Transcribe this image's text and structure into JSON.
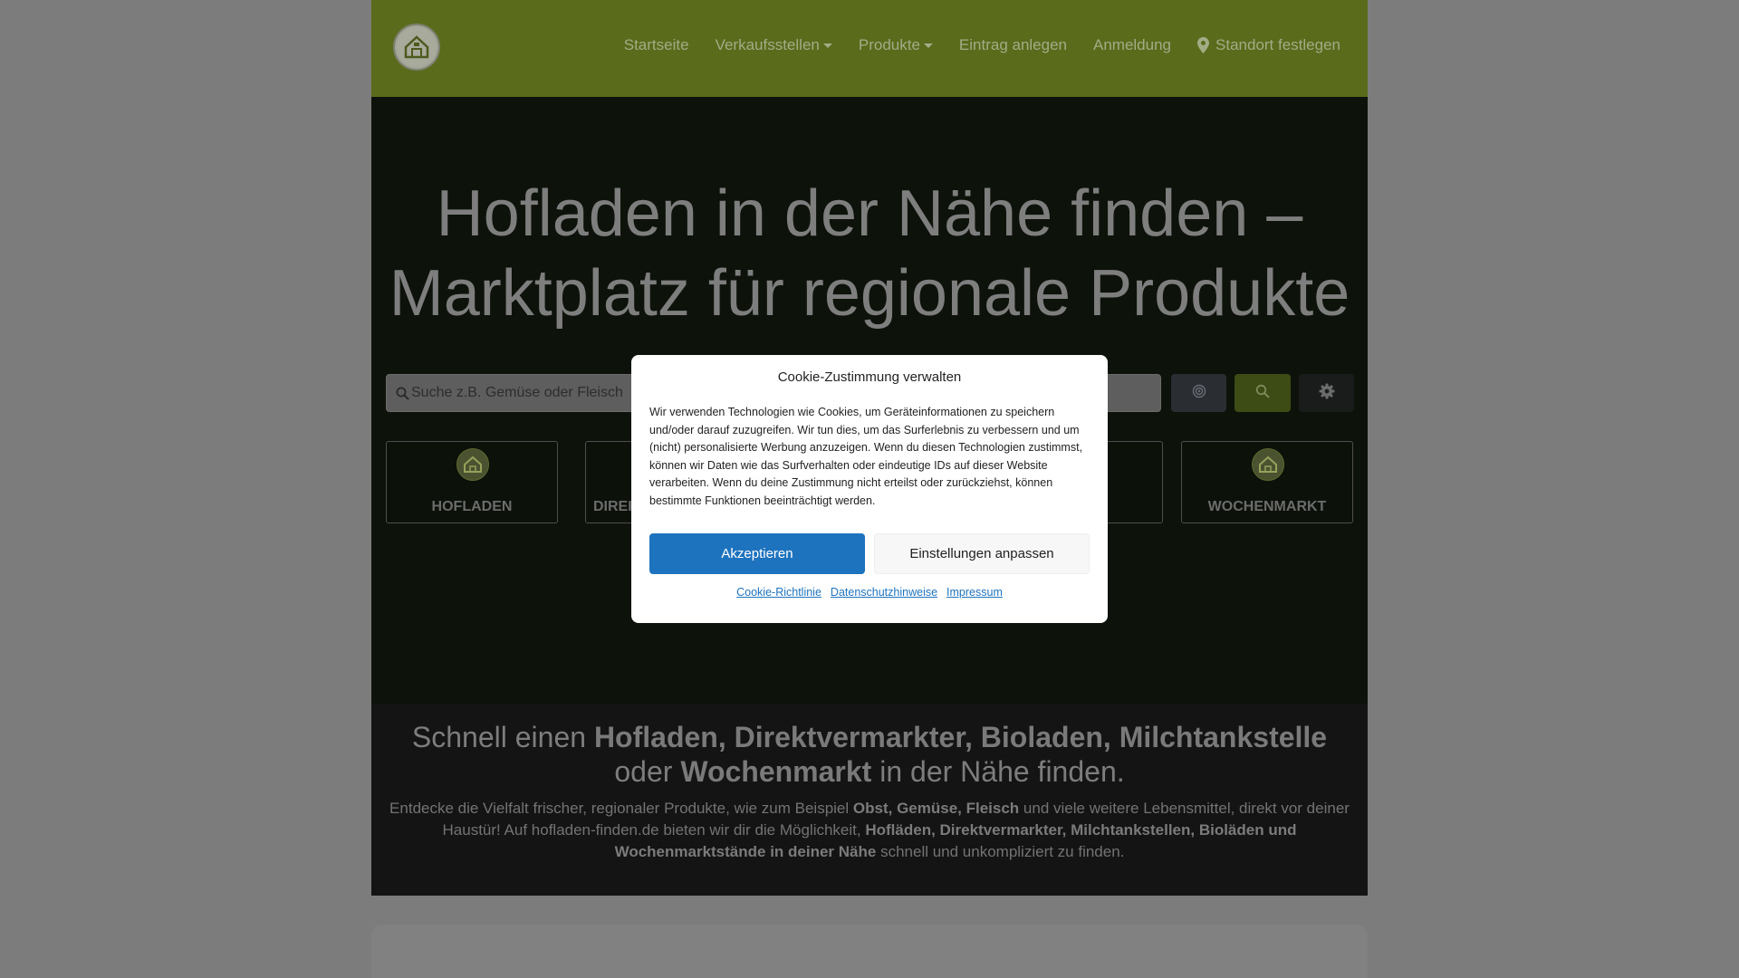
{
  "navbar": {
    "logo_icon": "farm-shop-logo-icon",
    "items": [
      {
        "label": "Startseite"
      },
      {
        "label": "Verkaufsstellen"
      },
      {
        "label": "Produkte"
      },
      {
        "label": "Eintrag anlegen"
      },
      {
        "label": "Anmeldung"
      },
      {
        "label": "Standort festlegen",
        "icon": "map-pin-icon"
      }
    ]
  },
  "hero": {
    "title": "Hofladen in der Nähe finden – Marktplatz für regionale Produkte",
    "search": {
      "placeholder": "Suche z.B. Gemüse oder Fleisch"
    },
    "buttons": {
      "locate_icon": "target-icon",
      "search_icon": "search-icon",
      "settings_icon": "gear-icon"
    },
    "categories": [
      {
        "label": "HOFLADEN"
      },
      {
        "label": "DIREI"
      },
      {
        "label": "WOCHENMARKT"
      }
    ]
  },
  "info": {
    "h_pre": "Schnell einen",
    "h_strong1": "Hofladen, Direktvermarkter, Bioladen, Milchtankstelle",
    "h_mid": "oder",
    "h_strong2": "Wochenmarkt",
    "h_post": "in der Nähe finden.",
    "p1": "Entdecke die Vielfalt frischer, regionaler Produkte, wie zum Beispiel",
    "p1_strong": "Obst, Gemüse, Fleisch",
    "p2": "und viele weitere Lebensmittel, direkt vor deiner Haustür! Auf hofladen-finden.de bieten wir dir die Möglichkeit,",
    "p2_strong": "Hofläden, Direktvermarkter, Milchtankstellen, Bioläden und Wochenmarktstände in deiner Nähe",
    "p3": "schnell und unkompliziert zu finden."
  },
  "cookie": {
    "title": "Cookie-Zustimmung verwalten",
    "text": "Wir verwenden Technologien wie Cookies, um Geräteinformationen zu speichern und/oder darauf zuzugreifen. Wir tun dies, um das Surferlebnis zu verbessern und um (nicht) personalisierte Werbung anzuzeigen. Wenn du diesen Technologien zustimmst, können wir Daten wie das Surfverhalten oder eindeutige IDs auf dieser Website verarbeiten. Wenn du deine Zustimmung nicht erteilst oder zurückziehst, können bestimmte Funktionen beeinträchtigt werden.",
    "accept": "Akzeptieren",
    "customize": "Einstellungen anpassen",
    "links": [
      "Cookie-Richtlinie",
      "Datenschutzhinweise",
      "Impressum"
    ]
  },
  "colors": {
    "navbar_bg": "#5a6b1c",
    "accept_button": "#1e73be",
    "hero_bg": "#0d130a"
  }
}
